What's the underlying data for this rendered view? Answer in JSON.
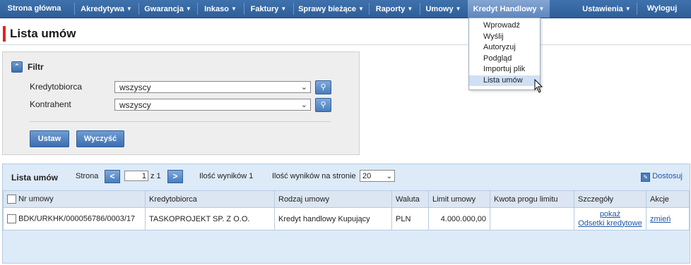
{
  "nav": {
    "items": [
      {
        "label": "Strona główna",
        "has_arrow": false
      },
      {
        "label": "Akredytywa",
        "has_arrow": true
      },
      {
        "label": "Gwarancja",
        "has_arrow": true
      },
      {
        "label": "Inkaso",
        "has_arrow": true
      },
      {
        "label": "Faktury",
        "has_arrow": true
      },
      {
        "label": "Sprawy bieżące",
        "has_arrow": true
      },
      {
        "label": "Raporty",
        "has_arrow": true
      },
      {
        "label": "Umowy",
        "has_arrow": true
      },
      {
        "label": "Kredyt Handlowy",
        "has_arrow": true,
        "active": true
      },
      {
        "label": "Ustawienia",
        "has_arrow": true
      },
      {
        "label": "Wyloguj",
        "has_arrow": false
      }
    ],
    "arrow_glyph": "▼"
  },
  "dropdown": {
    "items": [
      "Wprowadź",
      "Wyślij",
      "Autoryzuj",
      "Podgląd",
      "Importuj plik",
      "Lista umów"
    ],
    "selected": "Lista umów"
  },
  "page_title": "Lista umów",
  "filter": {
    "title": "Filtr",
    "fields": [
      {
        "label": "Kredytobiorca",
        "value": "wszyscy"
      },
      {
        "label": "Kontrahent",
        "value": "wszyscy"
      }
    ],
    "set_button": "Ustaw",
    "clear_button": "Wyczyść"
  },
  "list": {
    "title": "Lista umów",
    "page_label": "Strona",
    "page_value": "1",
    "of_label": "z 1",
    "results_label": "Ilość wyników 1",
    "per_page_label": "Ilość wyników na stronie",
    "per_page_value": "20",
    "customize_label": "Dostosuj",
    "columns": [
      "Nr umowy",
      "Kredytobiorca",
      "Rodzaj umowy",
      "Waluta",
      "Limit umowy",
      "Kwota progu limitu",
      "Szczegóły",
      "Akcje"
    ],
    "rows": [
      {
        "nr_umowy": "BDK/URKHK/000056786/0003/17",
        "kredytobiorca": "TASKOPROJEKT SP. Z O.O.",
        "rodzaj": "Kredyt handlowy Kupujący",
        "waluta": "PLN",
        "limit": "4.000.000,00",
        "prog": "",
        "szczegoly_1": "pokaż",
        "szczegoly_2": "Odsetki kredytowe",
        "akcje": "zmień"
      }
    ]
  },
  "colors": {
    "nav_bg": "#2f5e98",
    "accent_red": "#d9281e",
    "link": "#1f56a8"
  }
}
